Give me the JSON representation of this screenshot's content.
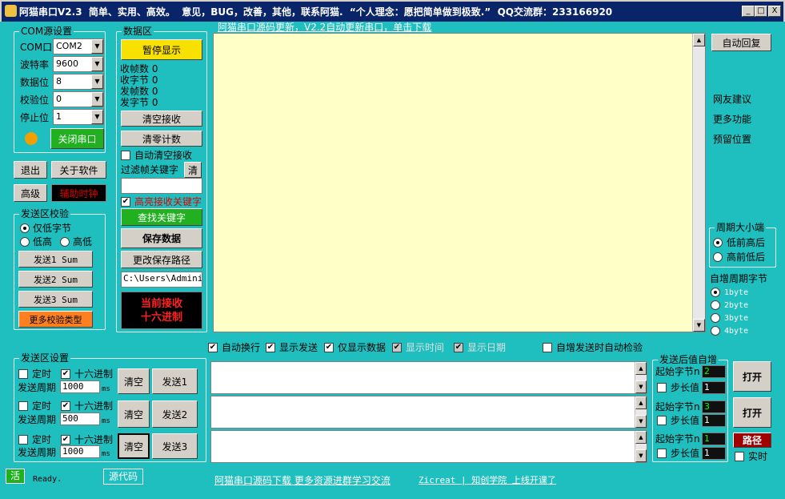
{
  "window": {
    "title": "阿猫串口V2.3  简单、实用、高效。  意见，BUG，改善，其他，联系阿猫.  “个人理念：愿把简单做到极致.”  QQ交流群：233166920",
    "min": "_",
    "max": "□",
    "close": "X"
  },
  "top_link": "阿猫串口源码更新，V2.2自动更新串口，单击下载",
  "com": {
    "title": "COM源设置",
    "port_label": "COM口",
    "port": "COM2",
    "baud_label": "波特率",
    "baud": "9600",
    "data_label": "数据位",
    "data": "8",
    "parity_label": "校验位",
    "parity": "0",
    "stop_label": "停止位",
    "stop": "1",
    "close_button": "关闭串口",
    "status_color": "#f0a000"
  },
  "buttons": {
    "exit": "退出",
    "about": "关于软件",
    "advanced": "高级",
    "aux_clock": "辅助时钟"
  },
  "data_area": {
    "title": "数据区",
    "pause": "暂停显示",
    "rx_frames": "收帧数 0",
    "rx_bytes": "收字节 0",
    "tx_frames": "发帧数 0",
    "tx_bytes": "发字节 0",
    "clear_rx": "清空接收",
    "clear_count": "清零计数",
    "auto_clear": "自动清空接收",
    "filter_label": "过滤帧关键字",
    "filter_clear": "清",
    "highlight": "高亮接收关键字",
    "find": "查找关键字",
    "save": "保存数据",
    "change_path": "更改保存路径",
    "path": "C:\\Users\\Adminis",
    "rx_mode_line1": "当前接收",
    "rx_mode_line2": "十六进制"
  },
  "checksum": {
    "title": "发送区校验",
    "only_low": "仅低字节",
    "low_high": "低高",
    "high_low": "高低",
    "send1": "发送1 Sum",
    "send2": "发送2 Sum",
    "send3": "发送3 Sum",
    "more": "更多校验类型"
  },
  "right": {
    "auto_reply": "自动回复",
    "suggest": "网友建议",
    "more_func": "更多功能",
    "reserved": "预留位置",
    "endian_title": "周期大小端",
    "low_first": "低前高后",
    "high_first": "高前低后",
    "inc_title": "自增周期字节",
    "b1": "1byte",
    "b2": "2byte",
    "b3": "3byte",
    "b4": "4byte"
  },
  "options": {
    "auto_newline": "自动换行",
    "show_send": "显示发送",
    "show_data_only": "仅显示数据",
    "show_time": "显示时间",
    "show_date": "显示日期",
    "auto_check": "自增发送时自动检验"
  },
  "send_area": {
    "title": "发送区设置",
    "rows": [
      {
        "timer": "定时",
        "hex": "十六进制",
        "period_label": "发送周期",
        "period": "1000",
        "unit": "ms",
        "clear": "清空",
        "send": "发送1"
      },
      {
        "timer": "定时",
        "hex": "十六进制",
        "period_label": "发送周期",
        "period": "500",
        "unit": "ms",
        "clear": "清空",
        "send": "发送2"
      },
      {
        "timer": "定时",
        "hex": "十六进制",
        "period_label": "发送周期",
        "period": "1000",
        "unit": "ms",
        "clear": "清空",
        "send": "发送3"
      }
    ]
  },
  "inc": {
    "title": "发送后值自增",
    "start_label": "起始字节n",
    "step_label": "步长值",
    "rows": [
      {
        "start": "2",
        "step": "1"
      },
      {
        "start": "3",
        "step": "1"
      },
      {
        "start": "1",
        "step": "1"
      }
    ],
    "open": "打开",
    "path": "路径",
    "realtime": "实时"
  },
  "status": {
    "live": "活",
    "ready": "Ready.",
    "source": "源代码",
    "link1": "阿猫串口源码下载 更多资源进群学习交流",
    "link2": "Zicreat | 知创学院 上线开课了"
  }
}
